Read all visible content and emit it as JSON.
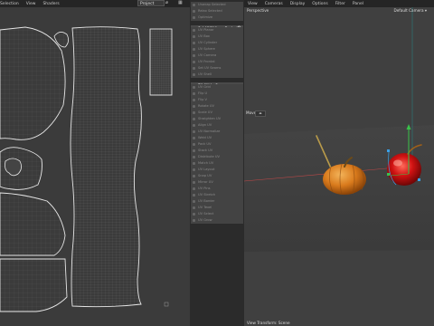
{
  "uv_menubar": [
    "Selection",
    "View",
    "Shaders"
  ],
  "viewport_menubar": [
    "View",
    "Cameras",
    "Display",
    "Options",
    "Filter",
    "Panel"
  ],
  "uv_toolbar": {
    "projection_select": "Project",
    "icons": [
      "magnet-icon",
      "grid-icon",
      "link-icon",
      "settings-icon"
    ]
  },
  "tool_buttons": [
    {
      "label": "Unwrap Selected",
      "active": false
    },
    {
      "label": "Relax Selected",
      "active": false
    },
    {
      "label": "Optimize",
      "active": false
    },
    {
      "label": "Set UVW from Projection",
      "active": true,
      "gear": true
    },
    {
      "label": "UV Planar",
      "active": false
    },
    {
      "label": "UV Box",
      "active": false
    },
    {
      "label": "UV Cylinder",
      "active": false
    },
    {
      "label": "UV Sphere",
      "active": false
    },
    {
      "label": "UV Camera",
      "active": false
    },
    {
      "label": "UV Frontal",
      "active": false
    },
    {
      "label": "Set UV Seams",
      "active": false
    },
    {
      "label": "UV Shell",
      "active": false
    },
    {
      "label": "Fit UV to Canvas",
      "active": true
    },
    {
      "label": "UV Grid",
      "active": false
    },
    {
      "label": "Flip U",
      "active": false
    },
    {
      "label": "Flip V",
      "active": false
    },
    {
      "label": "Rotate UV",
      "active": false
    },
    {
      "label": "Scale UV",
      "active": false
    },
    {
      "label": "Straighten UV",
      "active": false
    },
    {
      "label": "Align UV",
      "active": false
    },
    {
      "label": "UV Normalize",
      "active": false
    },
    {
      "label": "Weld UV",
      "active": false
    },
    {
      "label": "Pack UV",
      "active": false
    },
    {
      "label": "Stack UV",
      "active": false
    },
    {
      "label": "Distribute UV",
      "active": false
    },
    {
      "label": "Match UV",
      "active": false
    },
    {
      "label": "UV Layout",
      "active": false
    },
    {
      "label": "Snap UV",
      "active": false
    },
    {
      "label": "Mirror UV",
      "active": false
    },
    {
      "label": "UV Pins",
      "active": false
    },
    {
      "label": "UV Stretch",
      "active": false
    },
    {
      "label": "UV Border",
      "active": false
    },
    {
      "label": "UV Texel",
      "active": false
    },
    {
      "label": "UV Select",
      "active": false
    },
    {
      "label": "UV Grow",
      "active": false
    }
  ],
  "viewport": {
    "camera_label": "Perspective",
    "camera_name": "Default Camera ▾",
    "stepper_label": "Move",
    "status": "View Transform: Scene"
  },
  "colors": {
    "accent": "#3aa0e6",
    "axis_y": "#39c24a",
    "axis_x": "#e04040",
    "pumpkin": "#e08a28",
    "apple": "#d21a1a"
  }
}
